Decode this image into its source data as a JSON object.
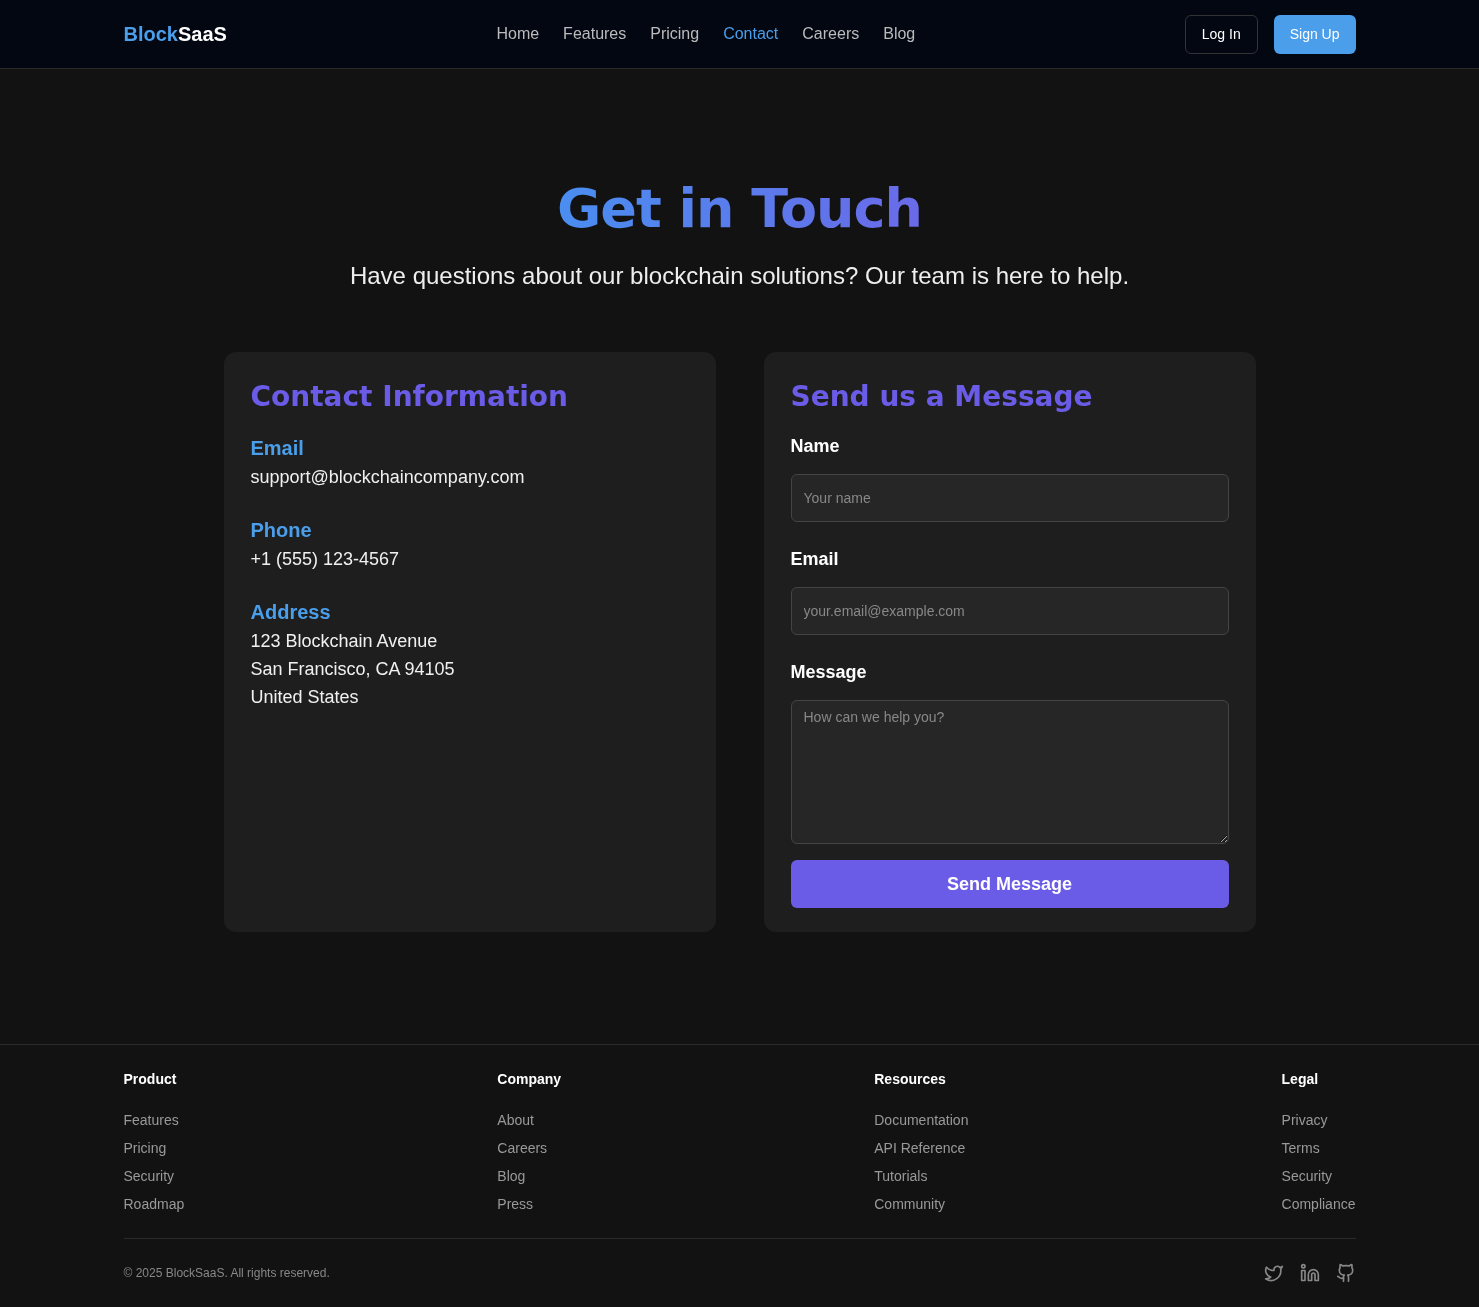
{
  "navbar": {
    "brand": {
      "accent": "Block",
      "rest": "SaaS"
    },
    "links": [
      {
        "label": "Home",
        "selected": false
      },
      {
        "label": "Features",
        "selected": false
      },
      {
        "label": "Pricing",
        "selected": false
      },
      {
        "label": "Contact",
        "selected": true
      },
      {
        "label": "Careers",
        "selected": false
      },
      {
        "label": "Blog",
        "selected": false
      }
    ],
    "login": "Log In",
    "signup": "Sign Up"
  },
  "hero": {
    "title": "Get in Touch",
    "subtitle": "Have questions about our blockchain solutions? Our team is here to help."
  },
  "contact_info": {
    "title": "Contact Information",
    "groups": [
      {
        "label": "Email",
        "lines": [
          "support@blockchaincompany.com"
        ]
      },
      {
        "label": "Phone",
        "lines": [
          "+1 (555) 123-4567"
        ]
      },
      {
        "label": "Address",
        "lines": [
          "123 Blockchain Avenue",
          "San Francisco, CA 94105",
          "United States"
        ]
      }
    ]
  },
  "form": {
    "title": "Send us a Message",
    "fields": [
      {
        "kind": "input",
        "label": "Name",
        "placeholder": "Your name"
      },
      {
        "kind": "input",
        "label": "Email",
        "placeholder": "your.email@example.com"
      },
      {
        "kind": "textarea",
        "label": "Message",
        "placeholder": "How can we help you?"
      }
    ],
    "submit": "Send Message"
  },
  "footer": {
    "columns": [
      {
        "title": "Product",
        "links": [
          "Features",
          "Pricing",
          "Security",
          "Roadmap"
        ]
      },
      {
        "title": "Company",
        "links": [
          "About",
          "Careers",
          "Blog",
          "Press"
        ]
      },
      {
        "title": "Resources",
        "links": [
          "Documentation",
          "API Reference",
          "Tutorials",
          "Community"
        ]
      },
      {
        "title": "Legal",
        "links": [
          "Privacy",
          "Terms",
          "Security",
          "Compliance"
        ]
      }
    ],
    "copyright": "© 2025 BlockSaaS. All rights reserved.",
    "social": [
      {
        "kind": "twitter"
      },
      {
        "kind": "linkedin"
      },
      {
        "kind": "github"
      }
    ]
  }
}
